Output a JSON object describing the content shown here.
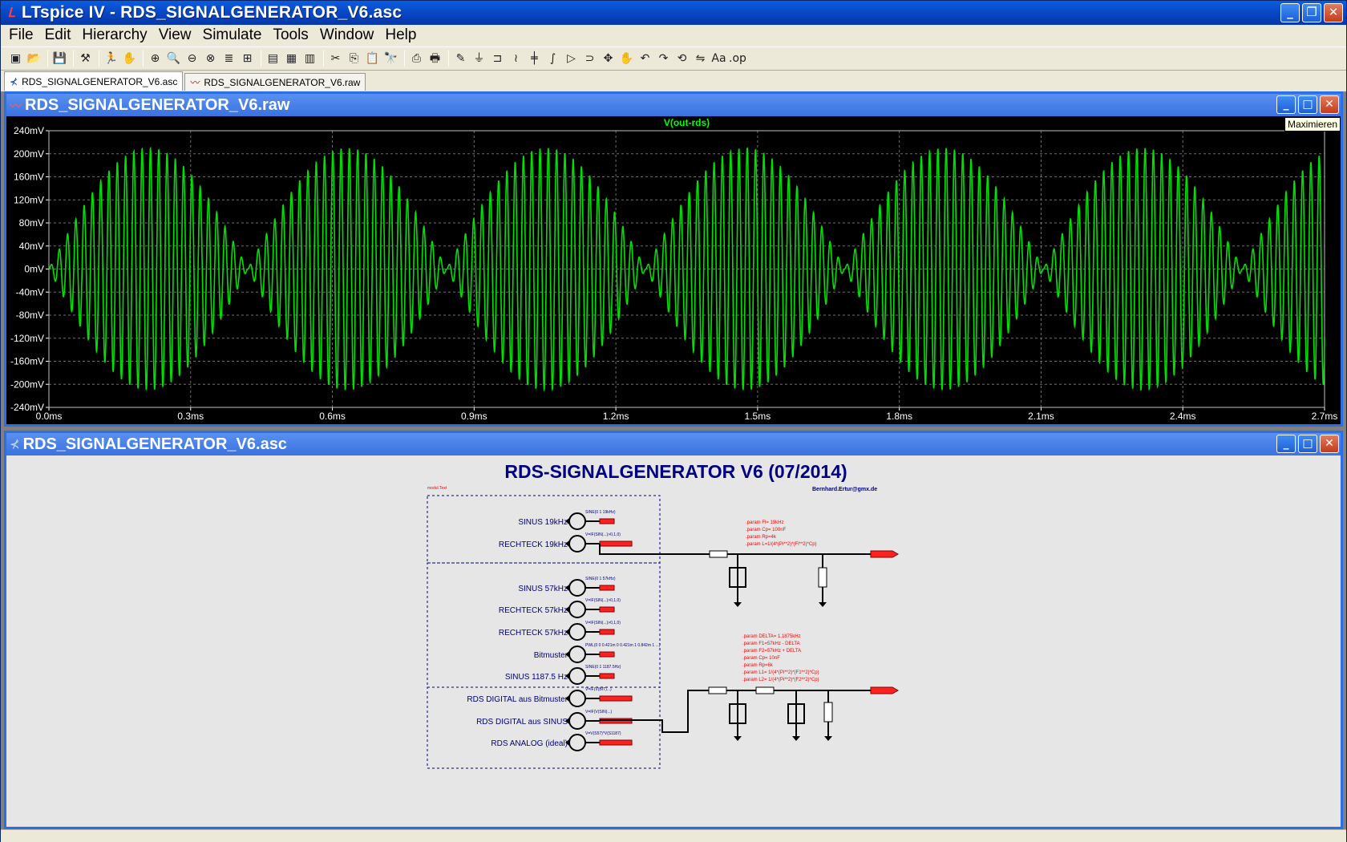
{
  "app": {
    "title": "LTspice IV - RDS_SIGNALGENERATOR_V6.asc",
    "window_buttons": {
      "minimize": "_",
      "restore": "❐",
      "close": "✕"
    }
  },
  "menu": [
    "File",
    "Edit",
    "Hierarchy",
    "View",
    "Simulate",
    "Tools",
    "Window",
    "Help"
  ],
  "toolbar_icons": [
    "new-schematic-icon",
    "open-icon",
    "save-icon",
    "control-panel-icon",
    "run-icon",
    "halt-icon",
    "zoom-in-icon",
    "zoom-pan-icon",
    "zoom-out-icon",
    "zoom-fit-icon",
    "autorange-icon",
    "plot-settings-icon",
    "tile-horizontal-icon",
    "cascade-icon",
    "tile-vertical-icon",
    "cut-icon",
    "copy-icon",
    "paste-icon",
    "find-icon",
    "print-preview-icon",
    "print-icon",
    "wire-icon",
    "ground-icon",
    "label-net-icon",
    "resistor-icon",
    "capacitor-icon",
    "inductor-icon",
    "diode-icon",
    "component-icon",
    "move-icon",
    "drag-icon",
    "undo-icon",
    "redo-icon",
    "rotate-icon",
    "mirror-icon",
    "text-icon",
    "spice-directive-icon"
  ],
  "toolbar_glyphs": [
    "▣",
    "📂",
    "💾",
    "⚒",
    "🏃",
    "✋",
    "⊕",
    "🔍",
    "⊖",
    "⊗",
    "≣",
    "⊞",
    "▤",
    "▦",
    "▥",
    "✂",
    "⎘",
    "📋",
    "🔭",
    "⎙",
    "🖶",
    "✎",
    "⏚",
    "⊐",
    "≀",
    "╪",
    "∫",
    "▷",
    "⊃",
    "✥",
    "✋",
    "↶",
    "↷",
    "⟲",
    "⇋",
    "Aa",
    ".op"
  ],
  "tabs": [
    {
      "label": "RDS_SIGNALGENERATOR_V6.asc",
      "icon": "schematic-icon",
      "glyph": "⊀"
    },
    {
      "label": "RDS_SIGNALGENERATOR_V6.raw",
      "icon": "waveform-icon",
      "glyph": "〰"
    }
  ],
  "waveform_window": {
    "title": "RDS_SIGNALGENERATOR_V6.raw",
    "tooltip": "Maximieren",
    "colors": {
      "background": "#000000",
      "trace": "#00e000",
      "grid": "#6e6e6e",
      "axis_text": "#ffffff",
      "title_text": "#00ff00"
    }
  },
  "chart_data": {
    "type": "line",
    "title": "V(out-rds)",
    "xlabel": "",
    "ylabel": "",
    "xlim": [
      0,
      2.7
    ],
    "ylim": [
      -240,
      240
    ],
    "x_unit": "ms",
    "y_unit": "mV",
    "x_ticks": [
      "0.0ms",
      "0.3ms",
      "0.6ms",
      "0.9ms",
      "1.2ms",
      "1.5ms",
      "1.8ms",
      "2.1ms",
      "2.4ms",
      "2.7ms"
    ],
    "y_ticks": [
      "240mV",
      "200mV",
      "160mV",
      "120mV",
      "80mV",
      "40mV",
      "0mV",
      "-40mV",
      "-80mV",
      "-120mV",
      "-160mV",
      "-200mV",
      "-240mV"
    ],
    "grid": true,
    "series": [
      {
        "name": "V(out-rds)",
        "carrier_khz": 57,
        "envelope_peak_mv": 210,
        "envelope_period_ms": 0.421,
        "description_values": "DSB-modulated 57kHz carrier with ~210mV peaks"
      }
    ]
  },
  "schematic_window": {
    "title": "RDS_SIGNALGENERATOR_V6.asc",
    "heading": "RDS-SIGNALGENERATOR V6 (07/2014)",
    "author": "Bernhard.Ertur@gmx.de",
    "corner_note": "modul.Text",
    "sources": [
      {
        "label": "SINUS 19kHz",
        "value": "SINE(0 1 19kHz)"
      },
      {
        "label": "RECHTECK 19kHz",
        "value": "V=IF(SIN(...)>0,1,0)"
      },
      {
        "label": "SINUS 57kHz",
        "value": "SINE(0 1 57kHz)"
      },
      {
        "label": "RECHTECK 57kHz",
        "value": "V=IF(SIN(...)>0,1,0)"
      },
      {
        "label": "RECHTECK 57kHz",
        "value": "V=IF(SIN(...)>0,1,0)"
      },
      {
        "label": "Bitmuster",
        "value": "PWL(0 0 0.421m 0 0.421m 1 0.842m 1 ...)"
      },
      {
        "label": "SINUS 1187.5 Hz",
        "value": "SINE(0 1 1187.5Hz)"
      },
      {
        "label": "RDS DIGITAL aus Bitmuster",
        "value": "V=IF(V(BIT)...)"
      },
      {
        "label": "RDS DIGITAL aus SINUS",
        "value": "V=IF(V(SIN)...)"
      },
      {
        "label": "RDS ANALOG (ideal)",
        "value": "V=V(S57)*V(S1187)"
      }
    ],
    "params_top": [
      ".param Fl= 19kHz",
      ".param Cp= 100nF",
      ".param Rp=4k",
      ".param L=1/(4*(Pi**2)*(Fl**2)*Cp)"
    ],
    "params_bottom": [
      ".param DELTA= 1.1875kHz",
      ".param F1=57kHz - DELTA",
      ".param F2=57kHz + DELTA",
      ".param Cp= 10nF",
      ".param Rp=6k",
      ".param L1= 1/(4*(Pi**2)*(F1**2)*Cp)",
      ".param L2= 1/(4*(Pi**2)*(F2**2)*Cp)"
    ],
    "colors": {
      "background": "#e6e6e6",
      "wire": "#000080",
      "text": "#000080",
      "directive": "#ff0000",
      "heading": "#000080"
    }
  }
}
